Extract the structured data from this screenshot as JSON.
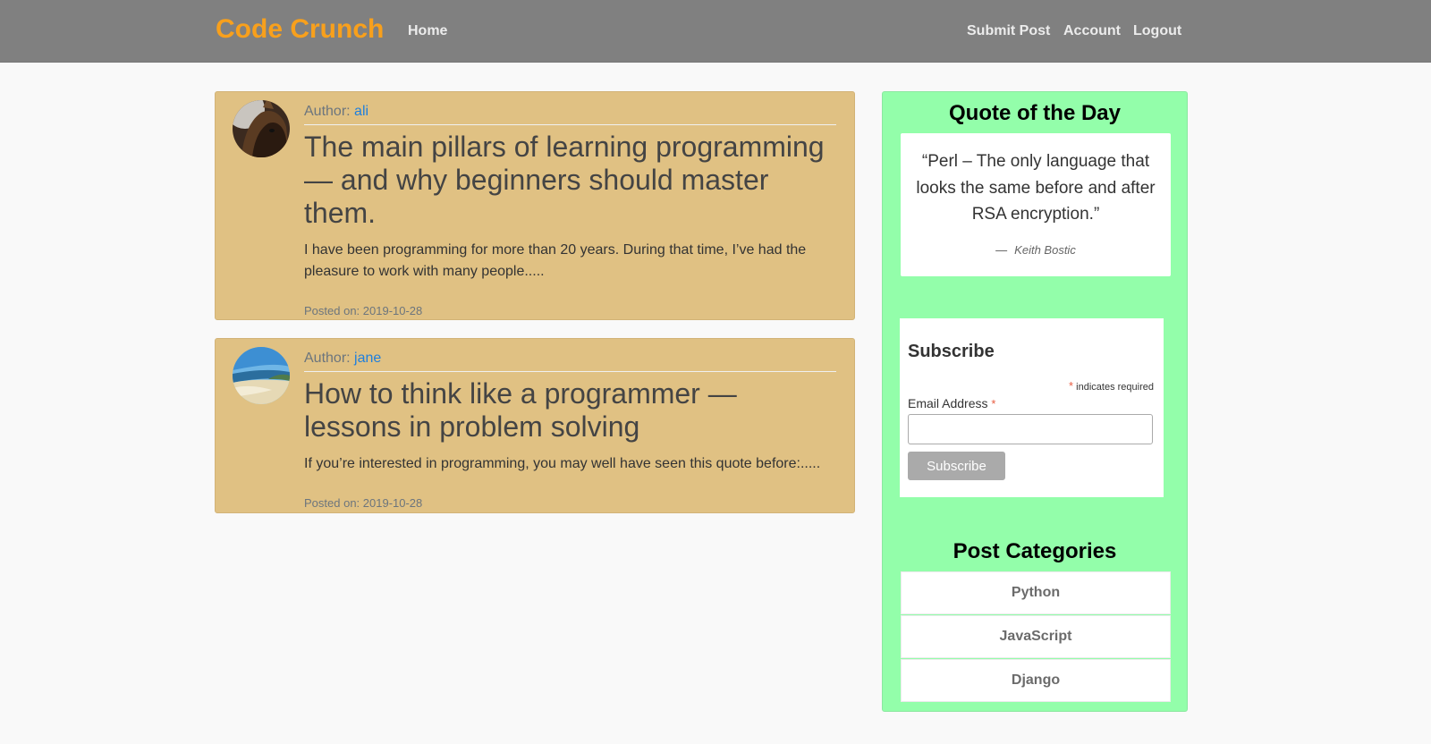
{
  "header": {
    "brand": "Code Crunch",
    "nav_home": "Home",
    "nav_submit": "Submit Post",
    "nav_account": "Account",
    "nav_logout": "Logout"
  },
  "posts": [
    {
      "author_prefix": "Author:",
      "author": "ali",
      "title": "The main pillars of learning programming — and why beginners should master them.",
      "excerpt": "I have been programming for more than 20 years. During that time, I’ve had the pleasure to work with many people.....",
      "date": "Posted on: 2019-10-28"
    },
    {
      "author_prefix": "Author:",
      "author": "jane",
      "title": "How to think like a programmer — lessons in problem solving",
      "excerpt": "If you’re interested in programming, you may well have seen this quote before:.....",
      "date": "Posted on: 2019-10-28"
    }
  ],
  "quote": {
    "heading": "Quote of the Day",
    "text": "“Perl – The only language that looks the same before and after RSA encryption.”",
    "dash": "—",
    "author": "Keith Bostic"
  },
  "subscribe": {
    "heading": "Subscribe",
    "required_star": "*",
    "required_note": " indicates required",
    "email_label": "Email Address",
    "button": "Subscribe"
  },
  "categories": {
    "heading": "Post Categories",
    "items": [
      "Python",
      "JavaScript",
      "Django"
    ]
  },
  "colors": {
    "brand": "#f8a01c",
    "navbar": "#808080",
    "post_card": "#e0c183",
    "sidebar": "#93feaa",
    "link": "#1f7fdd"
  }
}
